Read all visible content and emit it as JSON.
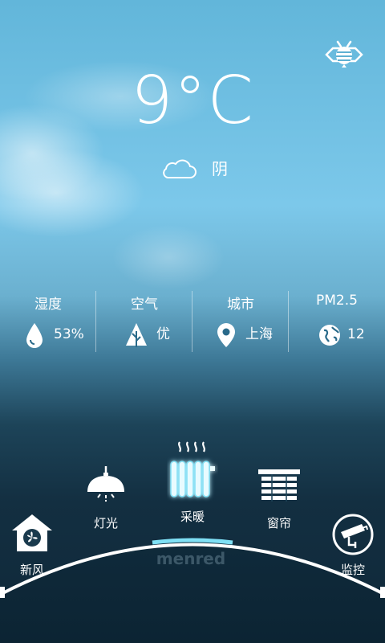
{
  "weather": {
    "temperature": "9°C",
    "condition": "阴",
    "condition_icon": "cloud-icon"
  },
  "stats": [
    {
      "label": "湿度",
      "value": "53%",
      "icon": "humidity-drop-icon"
    },
    {
      "label": "空气",
      "value": "优",
      "icon": "tree-icon"
    },
    {
      "label": "城市",
      "value": "上海",
      "icon": "location-pin-icon"
    },
    {
      "label": "PM2.5",
      "value": "12",
      "icon": "globe-icon"
    }
  ],
  "devices": [
    {
      "label": "新风",
      "icon": "fresh-air-house-icon"
    },
    {
      "label": "灯光",
      "icon": "lamp-icon"
    },
    {
      "label": "采暖",
      "icon": "radiator-icon",
      "selected": true
    },
    {
      "label": "窗帘",
      "icon": "curtain-icon"
    },
    {
      "label": "监控",
      "icon": "camera-icon"
    }
  ],
  "brand": "menred",
  "colors": {
    "accent": "#7fe0f5",
    "arc": "#ffffff"
  }
}
